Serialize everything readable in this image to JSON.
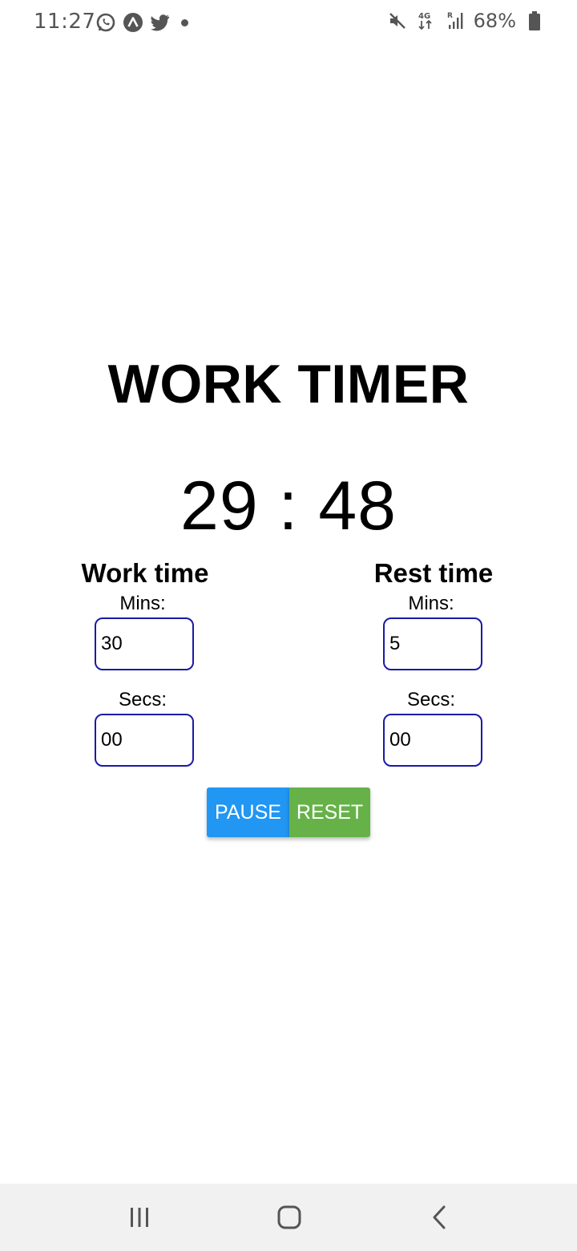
{
  "status_bar": {
    "time": "11:27",
    "battery": "68%",
    "left_icons": [
      "whatsapp-icon",
      "app-icon",
      "twitter-icon"
    ],
    "right_icons": [
      "mute-icon",
      "network-4g-icon",
      "signal-icon",
      "battery-icon"
    ]
  },
  "timer": {
    "title": "WORK TIMER",
    "display": "29 : 48"
  },
  "work": {
    "heading": "Work time",
    "mins_label": "Mins:",
    "mins_value": "30",
    "secs_label": "Secs:",
    "secs_value": "00"
  },
  "rest": {
    "heading": "Rest time",
    "mins_label": "Mins:",
    "mins_value": "5",
    "secs_label": "Secs:",
    "secs_value": "00"
  },
  "buttons": {
    "pause_label": "PAUSE",
    "reset_label": "RESET"
  },
  "colors": {
    "pause": "#2196f3",
    "reset": "#66b249",
    "input_border": "#1a1aa6"
  },
  "nav_bar": {
    "icons": [
      "recents-icon",
      "home-icon",
      "back-icon"
    ]
  }
}
